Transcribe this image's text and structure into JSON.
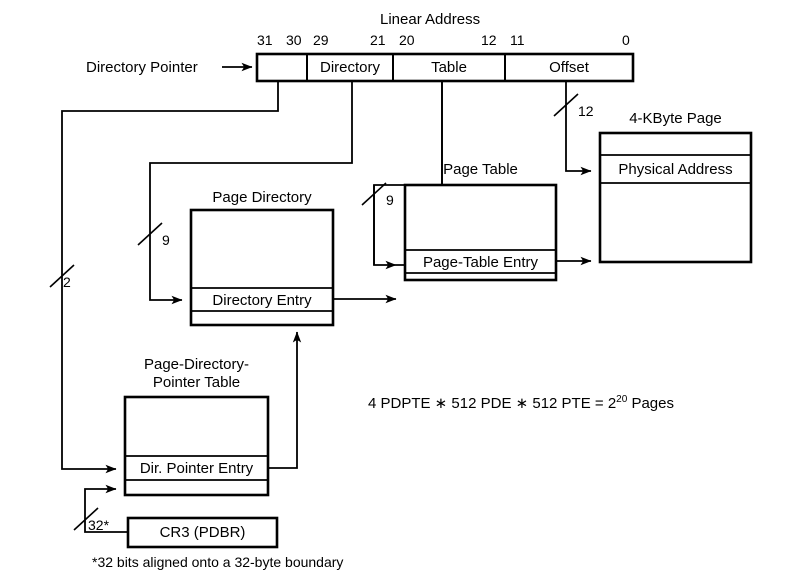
{
  "diagram": {
    "title": "Linear Address",
    "linear_address": {
      "bit_labels": [
        "31",
        "30",
        "29",
        "21",
        "20",
        "12",
        "11",
        "0"
      ],
      "fields": [
        {
          "name": "",
          "label": ""
        },
        {
          "name": "directory",
          "label": "Directory"
        },
        {
          "name": "table",
          "label": "Table"
        },
        {
          "name": "offset",
          "label": "Offset"
        }
      ]
    },
    "directory_pointer_label": "Directory Pointer",
    "boxes": {
      "page_directory": {
        "title": "Page Directory",
        "entry": "Directory Entry"
      },
      "page_table": {
        "title": "Page Table",
        "entry": "Page-Table Entry"
      },
      "four_kbyte_page": {
        "title": "4-KByte Page",
        "entry": "Physical Address"
      },
      "pdpt": {
        "title_line1": "Page-Directory-",
        "title_line2": "Pointer Table",
        "entry": "Dir. Pointer Entry"
      },
      "cr3": {
        "label": "CR3 (PDBR)"
      }
    },
    "slash_widths": {
      "offset": "12",
      "table": "9",
      "directory": "9",
      "dir_pointer": "2",
      "cr3": "32*"
    },
    "equation": {
      "prefix": "4 PDPTE ∗ 512 PDE ∗ 512 PTE = 2",
      "exponent": "20",
      "suffix": " Pages"
    },
    "footnote": "*32 bits aligned onto a 32-byte boundary"
  }
}
